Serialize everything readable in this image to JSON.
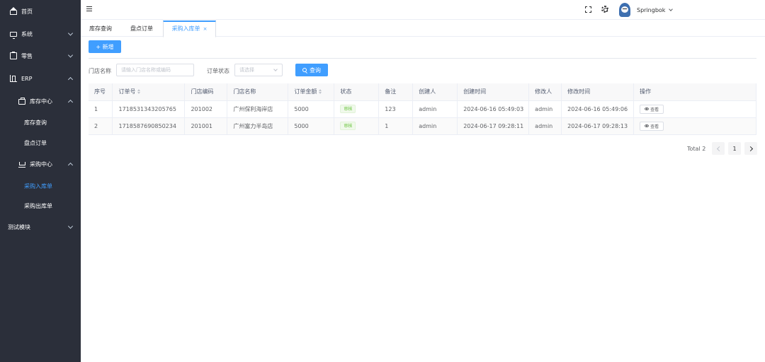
{
  "sidebar": {
    "items": [
      {
        "label": "首页",
        "icon": "home-icon"
      },
      {
        "label": "系统",
        "icon": "monitor-icon"
      },
      {
        "label": "零售",
        "icon": "clipboard-icon"
      },
      {
        "label": "ERP",
        "icon": "building-icon"
      },
      {
        "label": "库存中心",
        "icon": "bag-icon"
      },
      {
        "label": "库存查询"
      },
      {
        "label": "盘点订单"
      },
      {
        "label": "采购中心",
        "icon": "cart-icon"
      },
      {
        "label": "采购入库单"
      },
      {
        "label": "采购出库单"
      },
      {
        "label": "测试模块"
      }
    ]
  },
  "topbar": {
    "username": "Springbok"
  },
  "tabs": [
    {
      "label": "库存查询"
    },
    {
      "label": "盘点订单"
    },
    {
      "label": "采购入库单",
      "close": "×"
    }
  ],
  "toolbar": {
    "add_label": "+ 新增"
  },
  "filters": {
    "store_label": "门店名称",
    "store_placeholder": "请输入门店名称或编码",
    "status_label": "订单状态",
    "status_placeholder": "请选择",
    "query_label": "查询"
  },
  "table": {
    "headers": [
      "序号",
      "订单号",
      "门店编码",
      "门店名称",
      "订单金额",
      "状态",
      "备注",
      "创建人",
      "创建时间",
      "修改人",
      "修改时间",
      "操作"
    ],
    "rows": [
      {
        "index": "1",
        "order_no": "1718531343205765",
        "store_code": "201002",
        "store_name": "广州保利海岸店",
        "amount": "5000",
        "status": "审核",
        "remark": "123",
        "creator": "admin",
        "created": "2024-06-16 05:49:03",
        "modifier": "admin",
        "modified": "2024-06-16 05:49:06",
        "action": "查看"
      },
      {
        "index": "2",
        "order_no": "1718587690850234",
        "store_code": "201001",
        "store_name": "广州富力半岛店",
        "amount": "5000",
        "status": "审核",
        "remark": "1",
        "creator": "admin",
        "created": "2024-06-17 09:28:11",
        "modifier": "admin",
        "modified": "2024-06-17 09:28:13",
        "action": "查看"
      }
    ]
  },
  "pagination": {
    "total": "Total 2",
    "current": "1"
  },
  "colors": {
    "sidebar_bg": "#2b2f3a",
    "primary": "#409eff",
    "success": "#67c23a"
  }
}
